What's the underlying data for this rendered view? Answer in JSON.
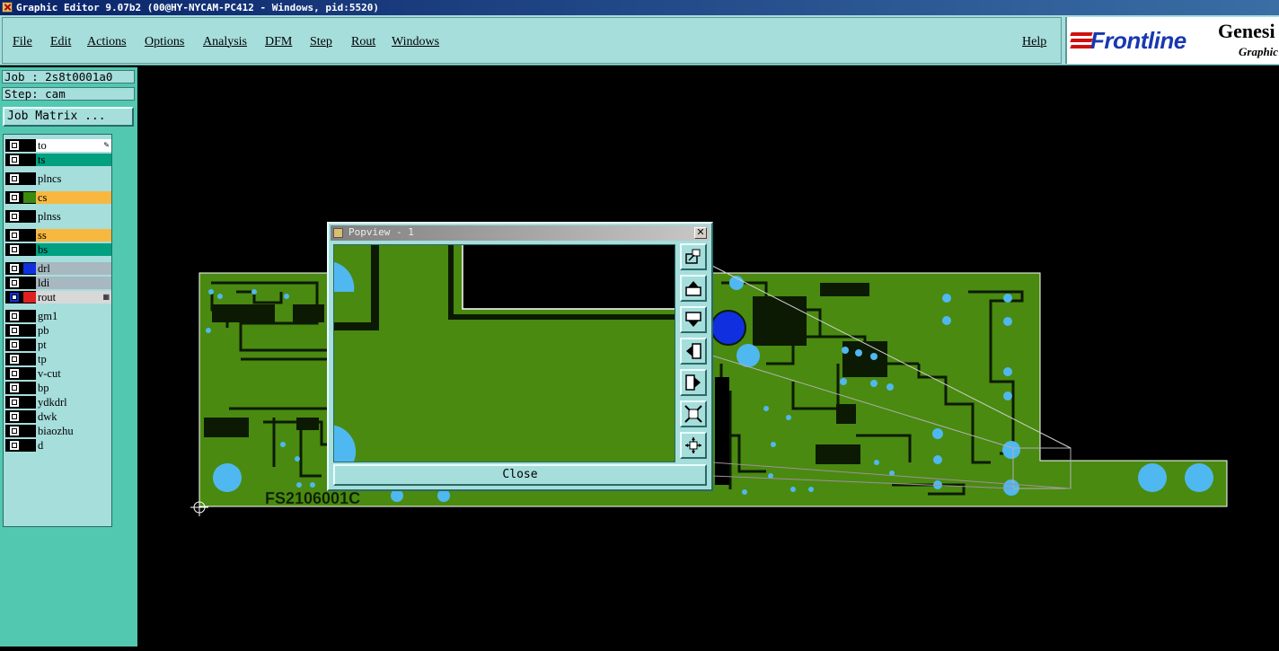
{
  "window": {
    "title": "Graphic Editor 9.07b2 (00@HY-NYCAM-PC412 - Windows, pid:5520)"
  },
  "menu": {
    "file": "File",
    "edit": "Edit",
    "actions": "Actions",
    "options": "Options",
    "analysis": "Analysis",
    "dfm": "DFM",
    "step": "Step",
    "rout": "Rout",
    "windows": "Windows",
    "help": "Help"
  },
  "logo": {
    "brand": "Frontline",
    "product": "Genesi",
    "subtitle": "Graphic"
  },
  "sidebar": {
    "job": "Job : 2s8t0001a0",
    "step": "Step: cam",
    "job_matrix": "Job Matrix ..."
  },
  "layers": [
    {
      "name": "to",
      "color": "#ffffff",
      "swatch": "#000000",
      "marker": "pencil"
    },
    {
      "name": "ts",
      "color": "#00a080",
      "swatch": "#000000"
    },
    {
      "name": "plncs",
      "color": "#a6dedc",
      "swatch": "#000000"
    },
    {
      "name": "cs",
      "color": "#f8b840",
      "swatch": "#3c8a10"
    },
    {
      "name": "plnss",
      "color": "#a6dedc",
      "swatch": "#000000"
    },
    {
      "name": "ss",
      "color": "#f8b840",
      "swatch": "#000000"
    },
    {
      "name": "bs",
      "color": "#00a080",
      "swatch": "#000000"
    },
    {
      "name": "drl",
      "color": "#a8b8c0",
      "swatch": "#1030e0"
    },
    {
      "name": "ldi",
      "color": "#a8b8c0",
      "swatch": "#000000"
    },
    {
      "name": "rout",
      "color": "#d8d8d8",
      "swatch": "#e02020",
      "marker": "grid"
    },
    {
      "name": "gm1",
      "color": "#a6dedc",
      "swatch": "#000000"
    },
    {
      "name": "pb",
      "color": "#a6dedc",
      "swatch": "#000000"
    },
    {
      "name": "pt",
      "color": "#a6dedc",
      "swatch": "#000000"
    },
    {
      "name": "tp",
      "color": "#a6dedc",
      "swatch": "#000000"
    },
    {
      "name": "v-cut",
      "color": "#a6dedc",
      "swatch": "#000000"
    },
    {
      "name": "bp",
      "color": "#a6dedc",
      "swatch": "#000000"
    },
    {
      "name": "ydkdrl",
      "color": "#a6dedc",
      "swatch": "#000000"
    },
    {
      "name": "dwk",
      "color": "#a6dedc",
      "swatch": "#000000"
    },
    {
      "name": "biaozhu",
      "color": "#a6dedc",
      "swatch": "#000000"
    },
    {
      "name": "d",
      "color": "#a6dedc",
      "swatch": "#000000"
    }
  ],
  "board": {
    "silk_text": "FS2106001C",
    "board_color": "#4a8a10",
    "pad_color": "#50b8f0",
    "drill_color": "#1030e0"
  },
  "popview": {
    "title": "Popview - 1",
    "close_label": "Close",
    "tools": [
      "zoom-window-icon",
      "pan-up-icon",
      "pan-down-icon",
      "pan-left-icon",
      "pan-right-icon",
      "zoom-fit-icon",
      "zoom-home-icon"
    ]
  }
}
